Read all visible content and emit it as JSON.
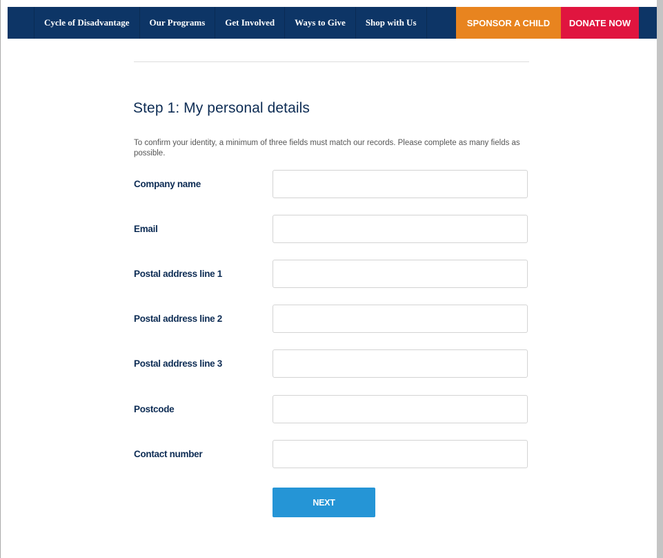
{
  "nav": {
    "items": [
      {
        "label": "Cycle of Disadvantage"
      },
      {
        "label": "Our Programs"
      },
      {
        "label": "Get Involved"
      },
      {
        "label": "Ways to Give"
      },
      {
        "label": "Shop with Us"
      }
    ],
    "sponsor_label": "SPONSOR A CHILD",
    "donate_label": "DONATE NOW",
    "colors": {
      "bar": "#0d3566",
      "sponsor": "#e8841f",
      "donate": "#e0153f"
    }
  },
  "form": {
    "title": "Step 1: My personal details",
    "intro": "To confirm your identity, a minimum of three fields must match our records. Please complete as many fields as possible.",
    "fields": [
      {
        "label": "Company name",
        "value": "",
        "placeholder": ""
      },
      {
        "label": "Email",
        "value": "",
        "placeholder": ""
      },
      {
        "label": "Postal address line 1",
        "value": "",
        "placeholder": ""
      },
      {
        "label": "Postal address line 2",
        "value": "",
        "placeholder": ""
      },
      {
        "label": "Postal address line 3",
        "value": "",
        "placeholder": ""
      },
      {
        "label": "Postcode",
        "value": "",
        "placeholder": ""
      },
      {
        "label": "Contact number",
        "value": "",
        "placeholder": ""
      }
    ],
    "next_label": "NEXT",
    "next_color": "#2595d6"
  }
}
